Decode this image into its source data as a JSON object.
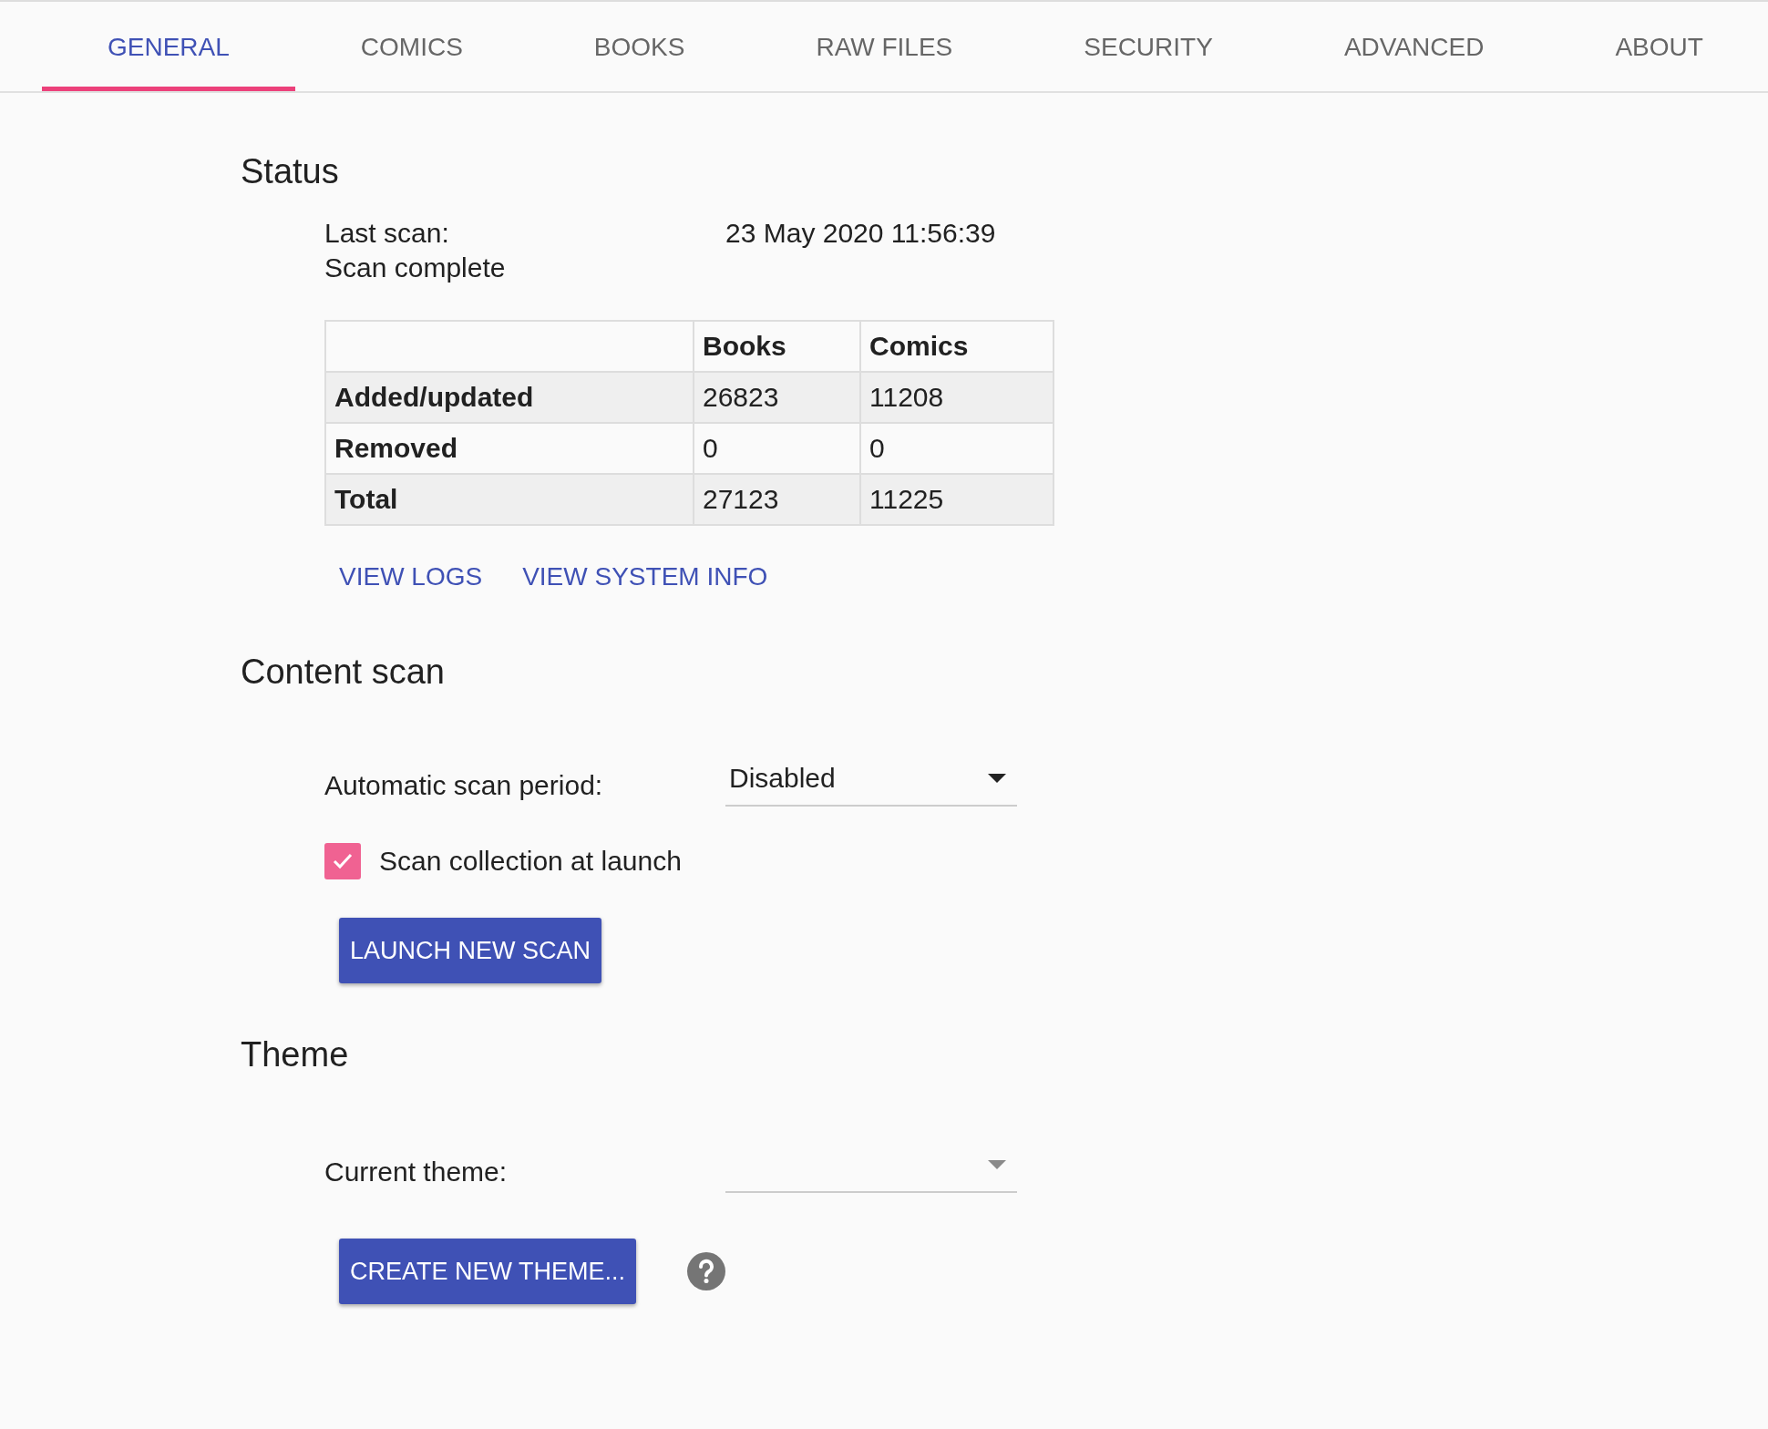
{
  "tabs": [
    {
      "label": "GENERAL",
      "selected": true
    },
    {
      "label": "COMICS",
      "selected": false
    },
    {
      "label": "BOOKS",
      "selected": false
    },
    {
      "label": "RAW FILES",
      "selected": false
    },
    {
      "label": "SECURITY",
      "selected": false
    },
    {
      "label": "ADVANCED",
      "selected": false
    },
    {
      "label": "ABOUT",
      "selected": false
    }
  ],
  "status": {
    "heading": "Status",
    "last_scan_label": "Last scan:",
    "last_scan_value": "23 May 2020 11:56:39",
    "scan_state": "Scan complete",
    "table": {
      "columns": [
        "",
        "Books",
        "Comics"
      ],
      "rows": [
        [
          "Added/updated",
          "26823",
          "11208"
        ],
        [
          "Removed",
          "0",
          "0"
        ],
        [
          "Total",
          "27123",
          "11225"
        ]
      ]
    },
    "links": [
      "VIEW LOGS",
      "VIEW SYSTEM INFO"
    ]
  },
  "content_scan": {
    "heading": "Content scan",
    "period_label": "Automatic scan period:",
    "period_value": "Disabled",
    "launch_checkbox": {
      "label": "Scan collection at launch",
      "checked": true
    },
    "button": "LAUNCH NEW SCAN"
  },
  "theme": {
    "heading": "Theme",
    "current_label": "Current theme:",
    "button": "CREATE NEW THEME..."
  }
}
